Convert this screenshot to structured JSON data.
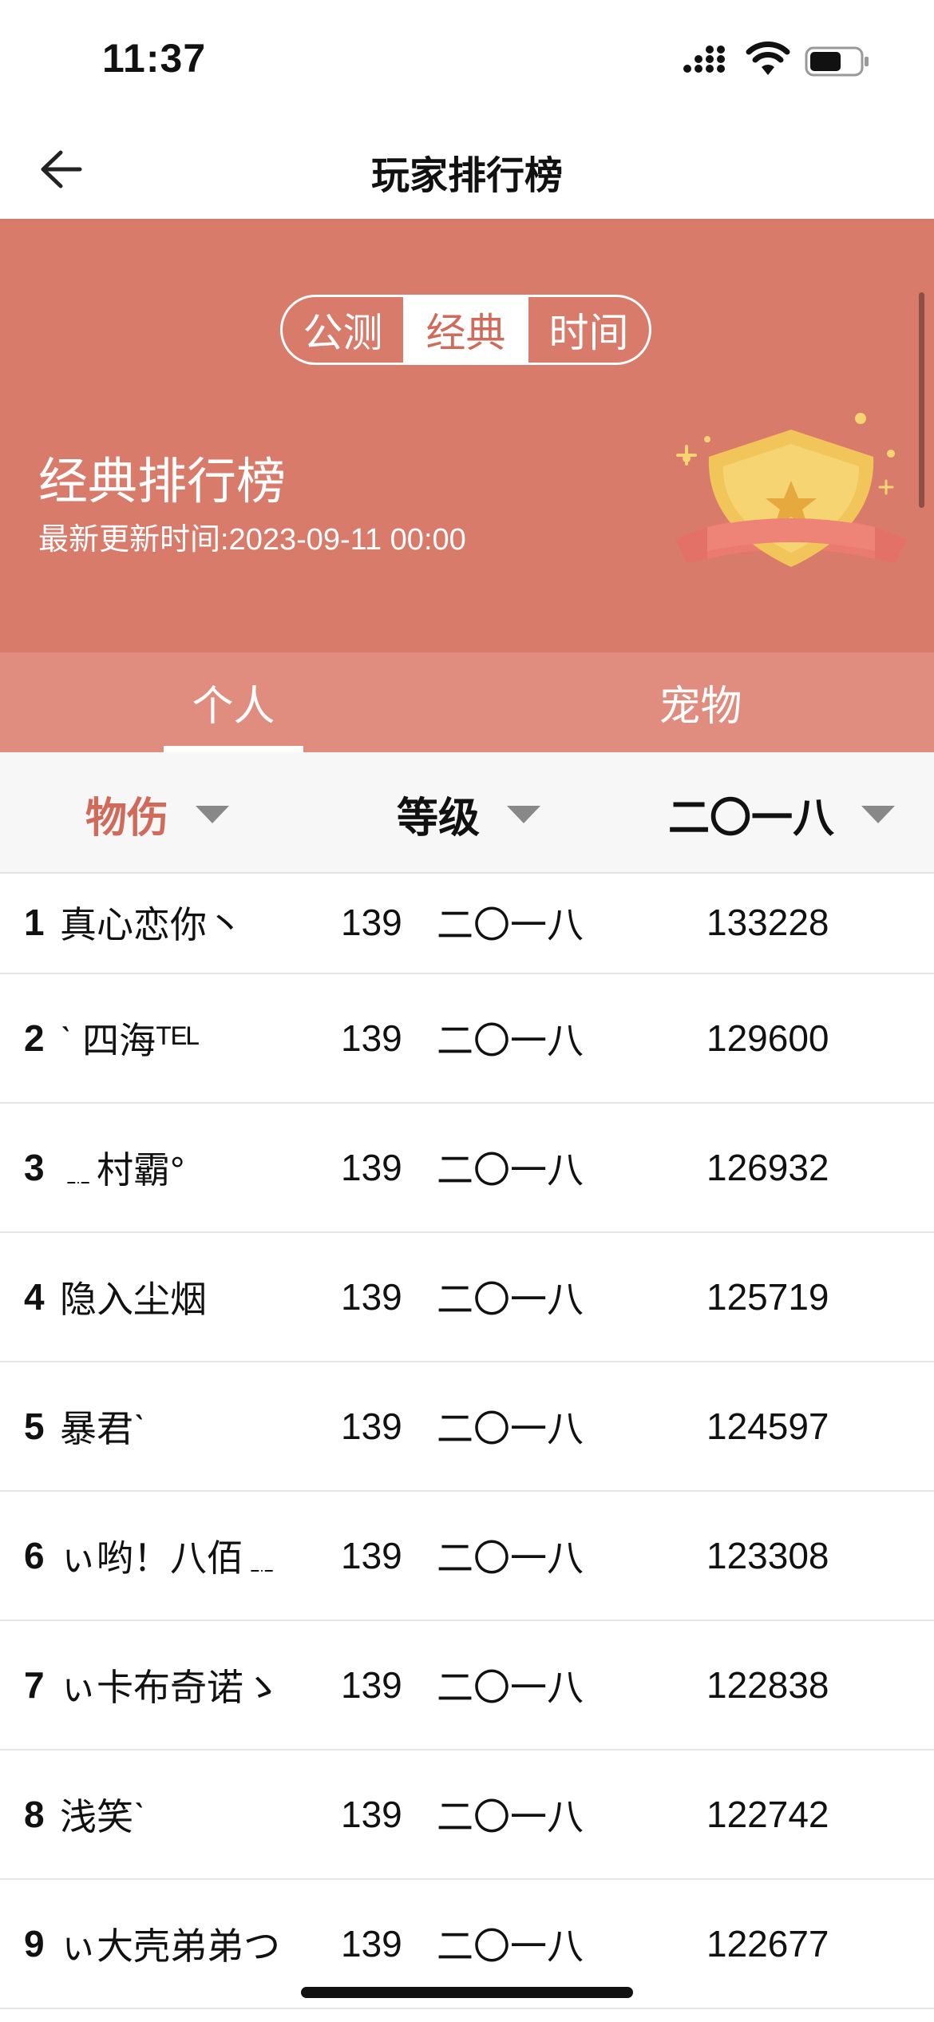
{
  "status": {
    "time": "11:37"
  },
  "nav": {
    "title": "玩家排行榜"
  },
  "banner": {
    "segments": [
      "公测",
      "经典",
      "时间"
    ],
    "active_segment": 1,
    "title": "经典排行榜",
    "subtitle": "最新更新时间:2023-09-11 00:00"
  },
  "tabs": {
    "items": [
      "个人",
      "宠物"
    ],
    "active": 0
  },
  "columns": {
    "col1": "物伤",
    "col2": "等级",
    "col3": "二〇一八"
  },
  "colors": {
    "banner": "#d97b6b",
    "tabs": "#e08d80",
    "accent": "#d06a5a"
  },
  "rows": [
    {
      "rank": "1",
      "name": "真心恋你丶",
      "level": "139",
      "tag": "二〇一八",
      "score": "133228"
    },
    {
      "rank": "2",
      "name": "ˋ 四海ᵀᴱᴸ",
      "level": "139",
      "tag": "二〇一八",
      "score": "129600"
    },
    {
      "rank": "3",
      "name": "﹎村霸°",
      "level": "139",
      "tag": "二〇一八",
      "score": "126932"
    },
    {
      "rank": "4",
      "name": "隐入尘烟",
      "level": "139",
      "tag": "二〇一八",
      "score": "125719"
    },
    {
      "rank": "5",
      "name": "暴君ˋ",
      "level": "139",
      "tag": "二〇一八",
      "score": "124597"
    },
    {
      "rank": "6",
      "name": "ぃ哟！八佰﹎",
      "level": "139",
      "tag": "二〇一八",
      "score": "123308"
    },
    {
      "rank": "7",
      "name": "ぃ卡布奇诺ゝ",
      "level": "139",
      "tag": "二〇一八",
      "score": "122838"
    },
    {
      "rank": "8",
      "name": "浅笑ˋ",
      "level": "139",
      "tag": "二〇一八",
      "score": "122742"
    },
    {
      "rank": "9",
      "name": "ぃ大壳弟弟つ",
      "level": "139",
      "tag": "二〇一八",
      "score": "122677"
    }
  ]
}
